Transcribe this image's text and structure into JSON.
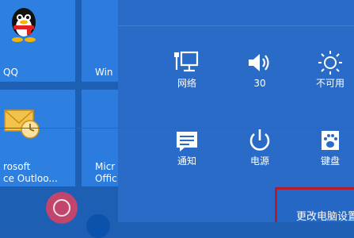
{
  "tiles": {
    "qq_label": "QQ",
    "win_label": "Win",
    "outlook_label_line1": "rosoft",
    "outlook_label_line2": "ce Outloo...",
    "office_label_line1": "Micr",
    "office_label_line2": "Offic"
  },
  "quick_settings": {
    "network_label": "网络",
    "volume_label": "30",
    "brightness_label": "不可用",
    "notifications_label": "通知",
    "power_label": "电源",
    "keyboard_label": "键盘"
  },
  "footer": {
    "change_pc_settings_label": "更改电脑设置"
  },
  "colors": {
    "panel": "#2a6bc7",
    "tile": "#2d7fe0",
    "accent_red": "#e3262a"
  }
}
